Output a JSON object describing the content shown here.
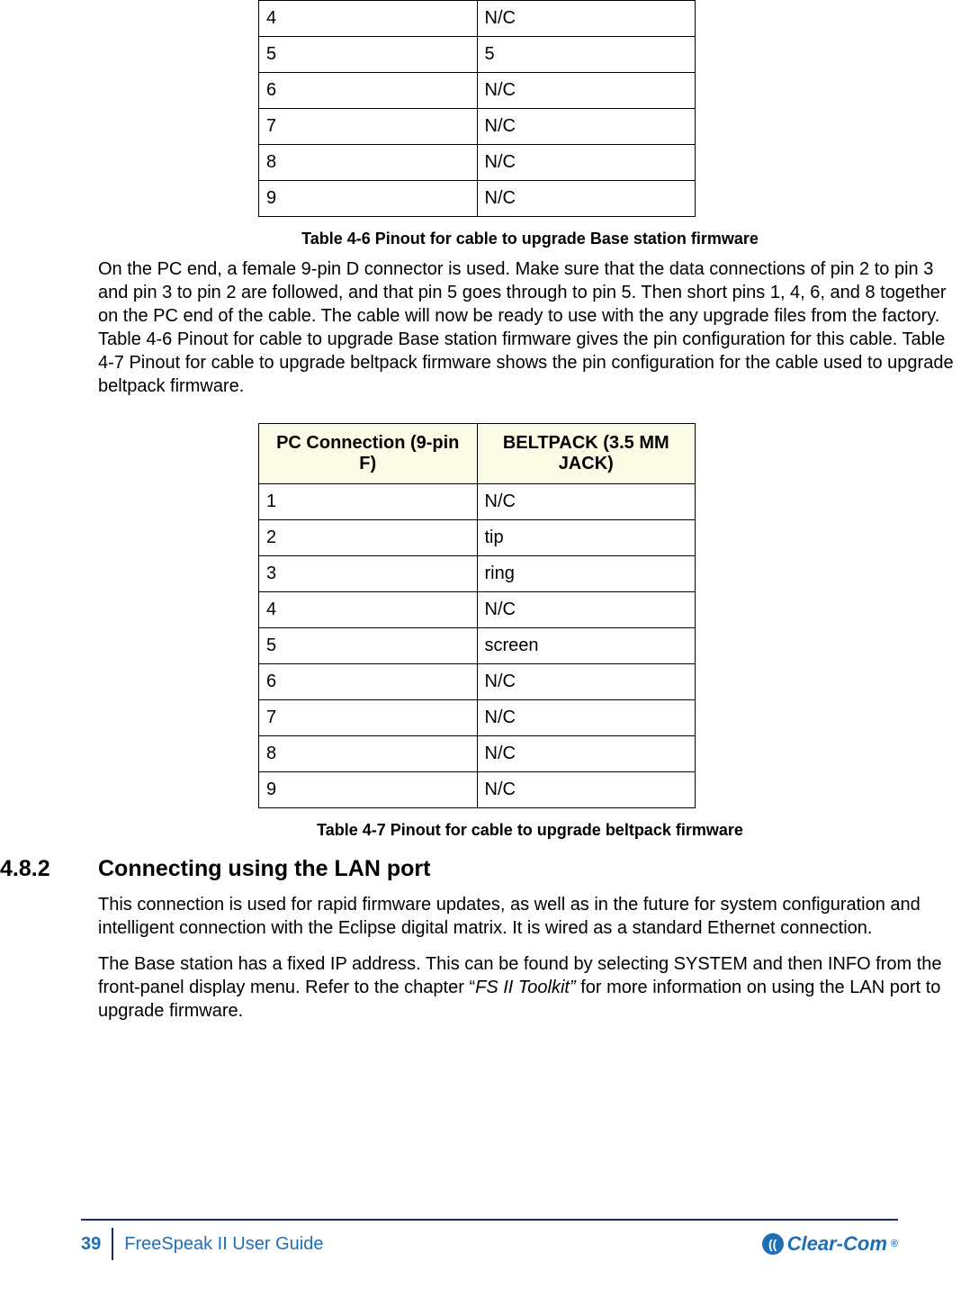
{
  "table1": {
    "rows": [
      {
        "c1": "4",
        "c2": "N/C"
      },
      {
        "c1": "5",
        "c2": "5"
      },
      {
        "c1": "6",
        "c2": "N/C"
      },
      {
        "c1": "7",
        "c2": "N/C"
      },
      {
        "c1": "8",
        "c2": "N/C"
      },
      {
        "c1": "9",
        "c2": "N/C"
      }
    ],
    "caption": "Table 4-6 Pinout for cable to upgrade Base station firmware"
  },
  "para1": "On the PC end, a female 9-pin D connector is used. Make sure that the data connections of pin 2 to pin 3 and pin 3 to pin 2 are followed, and that pin 5 goes through to pin 5. Then short pins 1, 4, 6, and 8 together on the PC end of the cable. The cable will now be ready to use with the any upgrade files from the factory. Table 4-6 Pinout for cable to upgrade Base station firmware gives the pin configuration for this cable. Table 4-7 Pinout for cable to upgrade beltpack firmware shows the pin configuration for the cable used to upgrade beltpack firmware.",
  "table2": {
    "headers": {
      "h1": "PC Connection (9-pin F)",
      "h2": "BELTPACK (3.5 MM JACK)"
    },
    "rows": [
      {
        "c1": "1",
        "c2": "N/C"
      },
      {
        "c1": "2",
        "c2": "tip"
      },
      {
        "c1": "3",
        "c2": "ring"
      },
      {
        "c1": "4",
        "c2": "N/C"
      },
      {
        "c1": "5",
        "c2": "screen"
      },
      {
        "c1": "6",
        "c2": "N/C"
      },
      {
        "c1": "7",
        "c2": "N/C"
      },
      {
        "c1": "8",
        "c2": "N/C"
      },
      {
        "c1": "9",
        "c2": "N/C"
      }
    ],
    "caption": "Table 4-7 Pinout for cable to upgrade beltpack firmware"
  },
  "section": {
    "num": "4.8.2",
    "title": "Connecting using the LAN port",
    "p1": "This connection is used for rapid firmware updates, as well as in the future for system configuration and intelligent connection with the Eclipse digital matrix. It is wired as a standard Ethernet connection.",
    "p2a": "The Base station has a fixed IP address. This can be found by selecting SYSTEM and then INFO from the front-panel display menu. Refer to the chapter “",
    "p2b": "FS II Toolkit”",
    "p2c": " for more information on using the LAN port to upgrade firmware."
  },
  "footer": {
    "page": "39",
    "title": "FreeSpeak II User Guide",
    "brand": "Clear-Com",
    "reg": "®"
  }
}
